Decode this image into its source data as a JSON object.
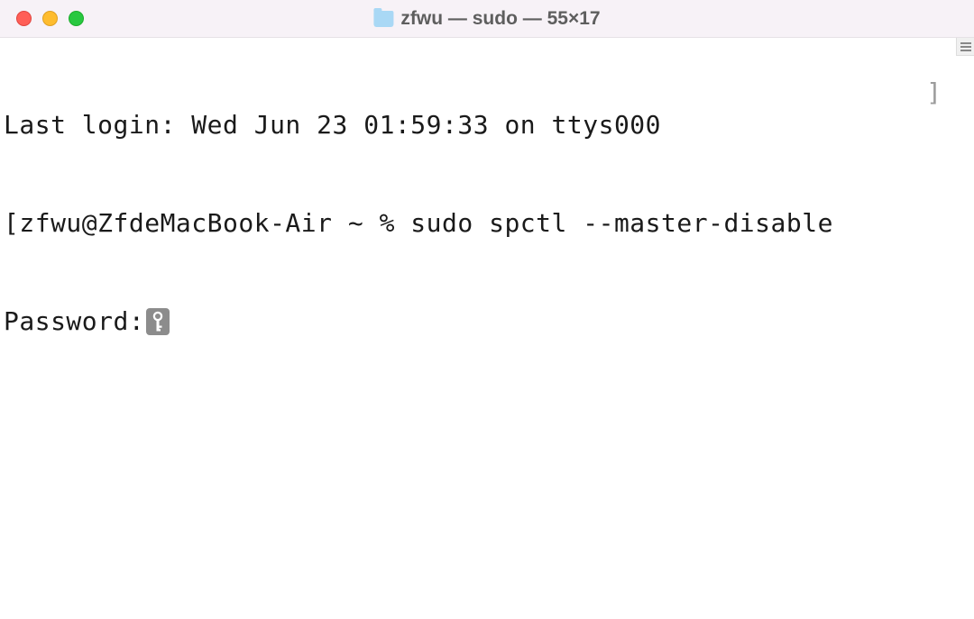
{
  "titlebar": {
    "title": "zfwu — sudo — 55×17"
  },
  "terminal": {
    "last_login": "Last login: Wed Jun 23 01:59:33 on ttys000",
    "prompt_line": "[zfwu@ZfdeMacBook-Air ~ % sudo spctl --master-disable",
    "password_label": "Password:",
    "right_bracket": "]"
  }
}
